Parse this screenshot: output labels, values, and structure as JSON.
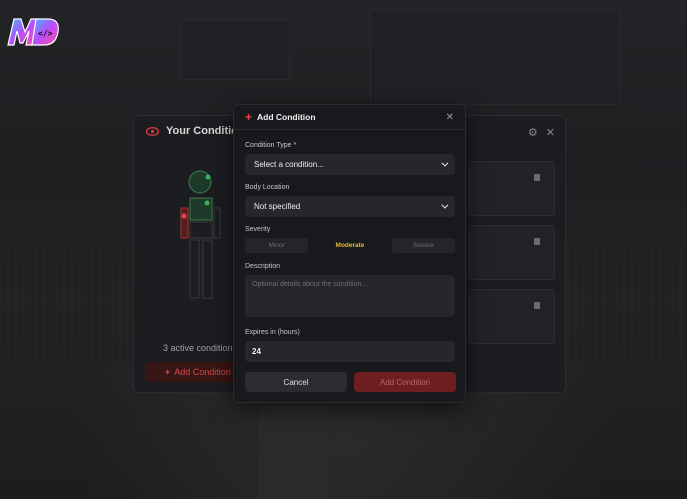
{
  "logo": {
    "text": "MD",
    "glyph": "</>"
  },
  "background_panel": {
    "title": "Your Conditio",
    "active_count": "3 active condition",
    "add_label": "Add Condition"
  },
  "modal": {
    "title": "Add Condition",
    "condition_type_label": "Condition Type *",
    "condition_type_value": "Select a condition...",
    "body_location_label": "Body Location",
    "body_location_value": "Not specified",
    "severity_label": "Severity",
    "severity_options": [
      "Minor",
      "Moderate",
      "Severe"
    ],
    "severity_selected": "Moderate",
    "description_label": "Description",
    "description_placeholder": "Optional details about the condition...",
    "expires_label": "Expires in (hours)",
    "expires_value": "24",
    "cancel_label": "Cancel",
    "submit_label": "Add Condition"
  },
  "colors": {
    "accent_red": "#e04646",
    "severity_active": "#e8b63a",
    "submit_bg": "#6e1e1e"
  }
}
